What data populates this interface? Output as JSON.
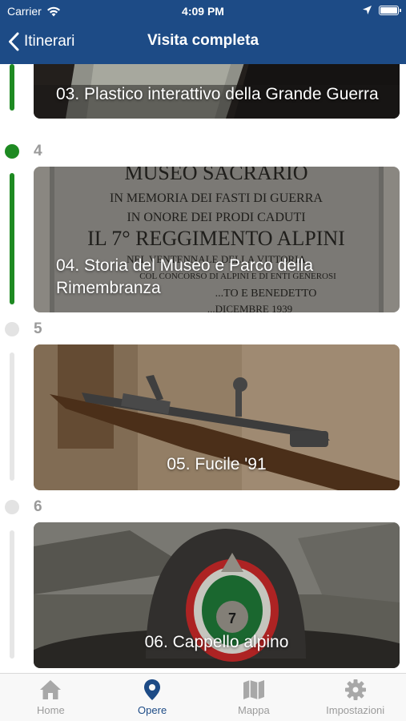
{
  "status_bar": {
    "carrier": "Carrier",
    "time": "4:09 PM"
  },
  "nav": {
    "back_label": "Itinerari",
    "title": "Visita completa"
  },
  "colors": {
    "nav_bg": "#1d4b86",
    "done": "#1e8a22",
    "pending": "#e3e3e3",
    "tab_active": "#1d4b86",
    "tab_inactive": "#9b9b9b"
  },
  "steps": [
    {
      "number": "3",
      "title": "03. Plastico interattivo della Grande Guerra",
      "completed": true
    },
    {
      "number": "4",
      "title": "04. Storia del Museo e Parco della Rimembranza",
      "completed": true
    },
    {
      "number": "5",
      "title": "05. Fucile '91",
      "completed": false
    },
    {
      "number": "6",
      "title": "06. Cappello alpino",
      "completed": false
    }
  ],
  "plaque": {
    "lines": [
      "MUSEO SACRARIO",
      "IN MEMORIA DEI FASTI DI GUERRA",
      "IN ONORE DEI PRODI CADUTI",
      "IL 7° REGGIMENTO ALPINI",
      "NEL VENTENNALE DELLA VITTORIA",
      "COL CONCORSO DI ALPINI E DI ENTI GENEROSI",
      "...TO E BENEDETTO",
      "...DICEMBRE 1939"
    ]
  },
  "hat_badge": "7",
  "tabbar": {
    "tabs": [
      {
        "label": "Home",
        "icon": "home-icon",
        "active": false
      },
      {
        "label": "Opere",
        "icon": "map-pin-icon",
        "active": true
      },
      {
        "label": "Mappa",
        "icon": "map-icon",
        "active": false
      },
      {
        "label": "Impostazioni",
        "icon": "gear-icon",
        "active": false
      }
    ]
  }
}
